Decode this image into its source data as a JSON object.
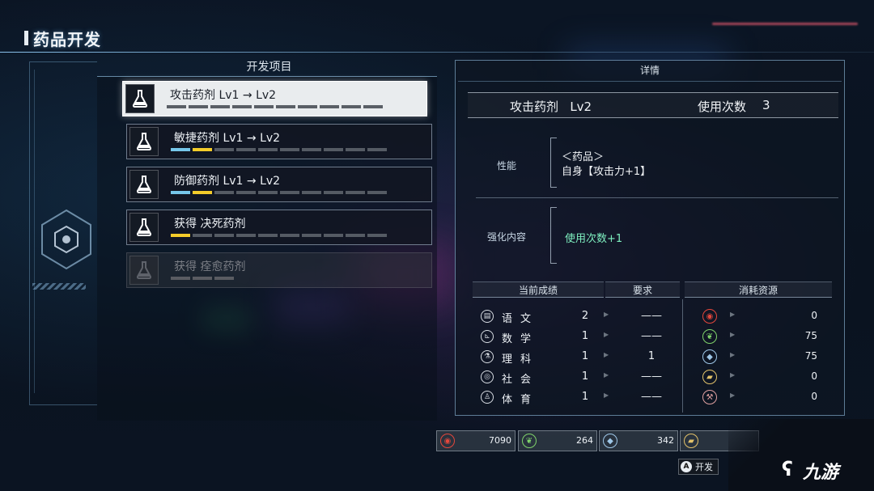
{
  "screen": {
    "title": "药品开发"
  },
  "list": {
    "header": "开发项目",
    "items": [
      {
        "label": "攻击药剂 Lv1 → Lv2",
        "state": "selected",
        "segments": [
          "blue",
          "yellow",
          "gray",
          "gray",
          "gray",
          "gray",
          "gray",
          "gray",
          "gray",
          "gray"
        ],
        "icon": "flask-icon"
      },
      {
        "label": "敏捷药剂 Lv1 → Lv2",
        "state": "normal",
        "segments": [
          "blue",
          "yellow",
          "gray",
          "gray",
          "gray",
          "gray",
          "gray",
          "gray",
          "gray",
          "gray"
        ],
        "icon": "flask-icon"
      },
      {
        "label": "防御药剂 Lv1 → Lv2",
        "state": "normal",
        "segments": [
          "blue",
          "yellow",
          "gray",
          "gray",
          "gray",
          "gray",
          "gray",
          "gray",
          "gray",
          "gray"
        ],
        "icon": "flask-icon"
      },
      {
        "label": "获得 决死药剂",
        "state": "normal",
        "segments": [
          "yellow",
          "gray",
          "gray",
          "gray",
          "gray",
          "gray",
          "gray",
          "gray",
          "gray",
          "gray"
        ],
        "icon": "flask-icon"
      },
      {
        "label": "获得 痊愈药剂",
        "state": "disabled",
        "segments": [
          "gray",
          "gray",
          "gray"
        ],
        "icon": "flask-icon"
      }
    ]
  },
  "detail": {
    "header": "详情",
    "name": "攻击药剂",
    "level": "Lv2",
    "uses_label": "使用次数",
    "uses_value": "3",
    "performance_label": "性能",
    "performance_lines": [
      "＜药品＞",
      "自身【攻击力+1】"
    ],
    "enhance_label": "强化内容",
    "enhance_text": "使用次数+1"
  },
  "stats_table": {
    "headers": {
      "current": "当前成绩",
      "required": "要求",
      "cost": "消耗资源"
    },
    "rows": [
      {
        "icon": "book-icon",
        "name": "语文",
        "value": "2",
        "required": "——"
      },
      {
        "icon": "math-icon",
        "name": "数学",
        "value": "1",
        "required": "——"
      },
      {
        "icon": "science-icon",
        "name": "理科",
        "value": "1",
        "required": "1"
      },
      {
        "icon": "society-icon",
        "name": "社会",
        "value": "1",
        "required": "——"
      },
      {
        "icon": "sports-icon",
        "name": "体育",
        "value": "1",
        "required": "——"
      }
    ],
    "resources": [
      {
        "icon": "red-gem-icon",
        "color": "#e4473c",
        "value": "0"
      },
      {
        "icon": "leaf-icon",
        "color": "#7fd36a",
        "value": "75"
      },
      {
        "icon": "crystal-icon",
        "color": "#9fc8e8",
        "value": "75"
      },
      {
        "icon": "gold-ore-icon",
        "color": "#e3c26a",
        "value": "0"
      },
      {
        "icon": "hammer-icon",
        "color": "#e0a0a0",
        "value": "0"
      }
    ]
  },
  "bottom_resources": [
    {
      "icon": "red-gem-icon",
      "color": "#e4473c",
      "value": "7090"
    },
    {
      "icon": "leaf-icon",
      "color": "#7fd36a",
      "value": "264"
    },
    {
      "icon": "crystal-icon",
      "color": "#9fc8e8",
      "value": "342"
    },
    {
      "icon": "gold-ore-icon",
      "color": "#e3c26a",
      "value": ""
    }
  ],
  "button_hint": {
    "key": "A",
    "label": "开发"
  },
  "watermark": {
    "text": "九游"
  }
}
